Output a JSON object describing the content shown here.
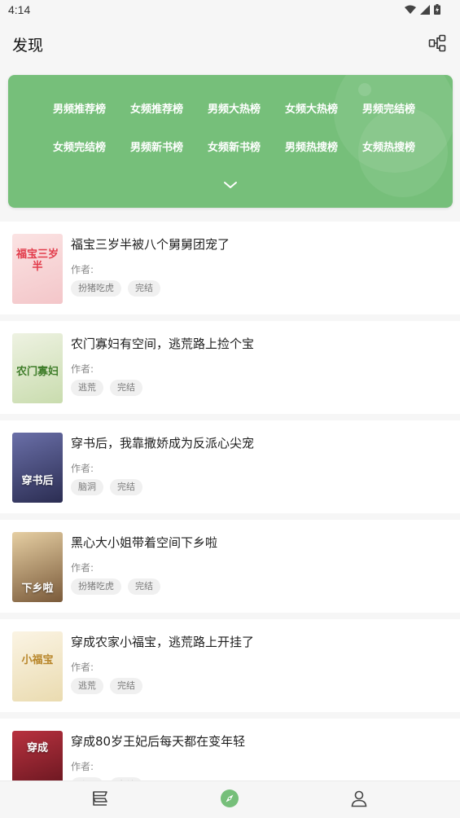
{
  "status_bar": {
    "time": "4:14"
  },
  "header": {
    "title": "发现",
    "scan_icon": "scan-share-icon"
  },
  "rank_panel": {
    "color": "#76bf7a",
    "items": [
      {
        "label": "男频推荐榜"
      },
      {
        "label": "女频推荐榜"
      },
      {
        "label": "男频大热榜"
      },
      {
        "label": "女频大热榜"
      },
      {
        "label": "男频完结榜"
      },
      {
        "label": "女频完结榜"
      },
      {
        "label": "男频新书榜"
      },
      {
        "label": "女频新书榜"
      },
      {
        "label": "男频热搜榜"
      },
      {
        "label": "女频热搜榜"
      }
    ],
    "expand_icon": "chevron-down-icon"
  },
  "books": [
    {
      "title": "福宝三岁半被八个舅舅团宠了",
      "author_label": "作者:",
      "tags": [
        "扮猪吃虎",
        "完结"
      ],
      "cover_text": "福宝三岁半",
      "cover_bg": "#f3d6d6"
    },
    {
      "title": "农门寡妇有空间，逃荒路上捡个宝",
      "author_label": "作者:",
      "tags": [
        "逃荒",
        "完结"
      ],
      "cover_text": "农门寡妇",
      "cover_bg": "#dfe8cf"
    },
    {
      "title": "穿书后，我靠撒娇成为反派心尖宠",
      "author_label": "作者:",
      "tags": [
        "脑洞",
        "完结"
      ],
      "cover_text": "穿书后",
      "cover_bg": "#3a3f6b"
    },
    {
      "title": "黑心大小姐带着空间下乡啦",
      "author_label": "作者:",
      "tags": [
        "扮猪吃虎",
        "完结"
      ],
      "cover_text": "下乡啦",
      "cover_bg": "#c9a77a"
    },
    {
      "title": "穿成农家小福宝，逃荒路上开挂了",
      "author_label": "作者:",
      "tags": [
        "逃荒",
        "完结"
      ],
      "cover_text": "小福宝",
      "cover_bg": "#f1e6c8"
    },
    {
      "title": "穿成80岁王妃后每天都在变年轻",
      "author_label": "作者:",
      "tags": [
        "脑洞",
        "完结"
      ],
      "cover_text": "穿成",
      "cover_bg": "#8a1f2a"
    }
  ],
  "bottom_nav": {
    "items": [
      {
        "name": "bookshelf-icon"
      },
      {
        "name": "discover-compass-icon",
        "active_color": "#76bf7a"
      },
      {
        "name": "profile-icon"
      }
    ]
  }
}
